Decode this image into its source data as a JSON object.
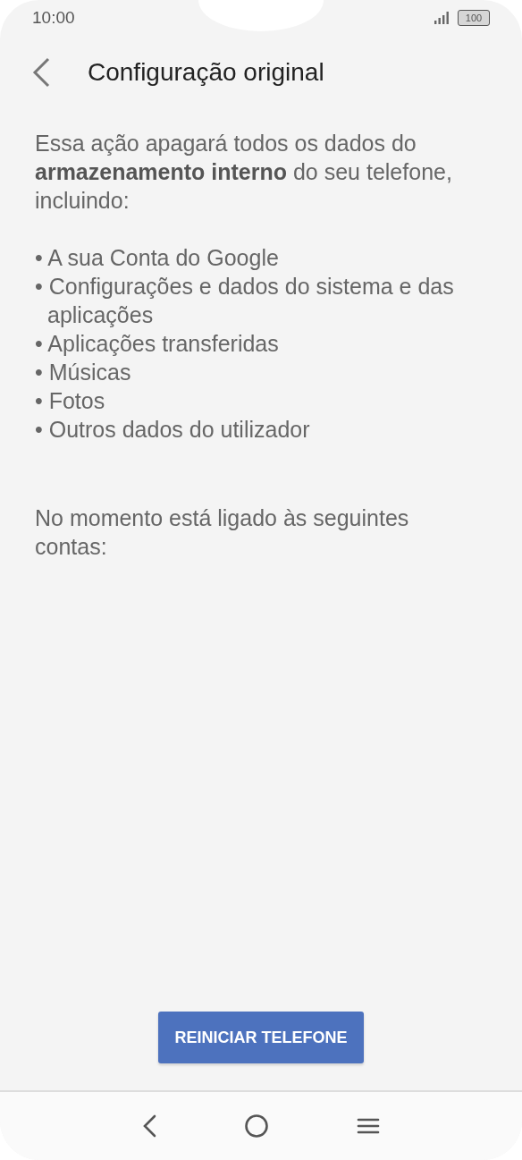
{
  "status_bar": {
    "time": "10:00",
    "battery": "100"
  },
  "header": {
    "title": "Configuração original"
  },
  "intro": "Essa ação apagará todos os dados do **armazenamento interno** do seu telefone, incluindo:",
  "items": [
    "• A sua Conta do Google",
    "• Configurações e dados do sistema e das aplicações",
    "• Aplicações transferidas",
    "• Músicas",
    "• Fotos",
    "• Outros dados do utilizador"
  ],
  "accounts_note": "No momento está ligado às seguintes contas:",
  "button": "REINICIAR TELEFONE"
}
